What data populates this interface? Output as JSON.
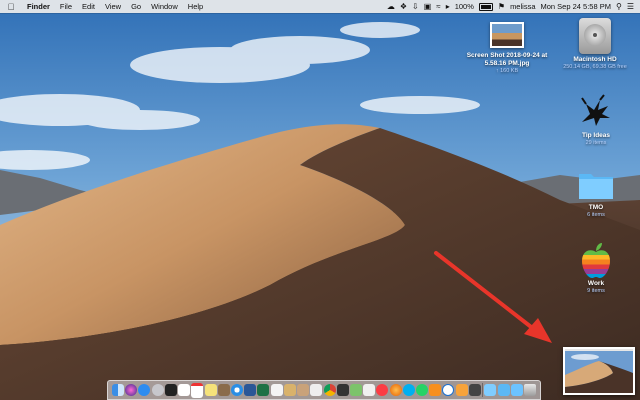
{
  "menubar": {
    "apple_icon": "apple-icon",
    "app_name": "Finder",
    "menus": [
      "File",
      "Edit",
      "View",
      "Go",
      "Window",
      "Help"
    ],
    "battery": "100%",
    "user": "melissa",
    "datetime": "Mon Sep 24  5:58 PM"
  },
  "desktop": {
    "screenshot": {
      "title_line1": "Screen Shot 2018-09-24 at",
      "title_line2": "5.58.16 PM.jpg",
      "sub": "↑ 160 KB"
    },
    "hd": {
      "title": "Macintosh HD",
      "sub": "250.14 GB, 69.38 GB free"
    },
    "tip_ideas": {
      "title": "Tip Ideas",
      "sub": "29 items"
    },
    "tmo": {
      "title": "TMO",
      "sub": "6 items"
    },
    "work": {
      "title": "Work",
      "sub": "9 items"
    }
  },
  "colors": {
    "arrow": "#e8352a",
    "folder": "#6cc3ff",
    "menubar_bg": "#ececec"
  }
}
